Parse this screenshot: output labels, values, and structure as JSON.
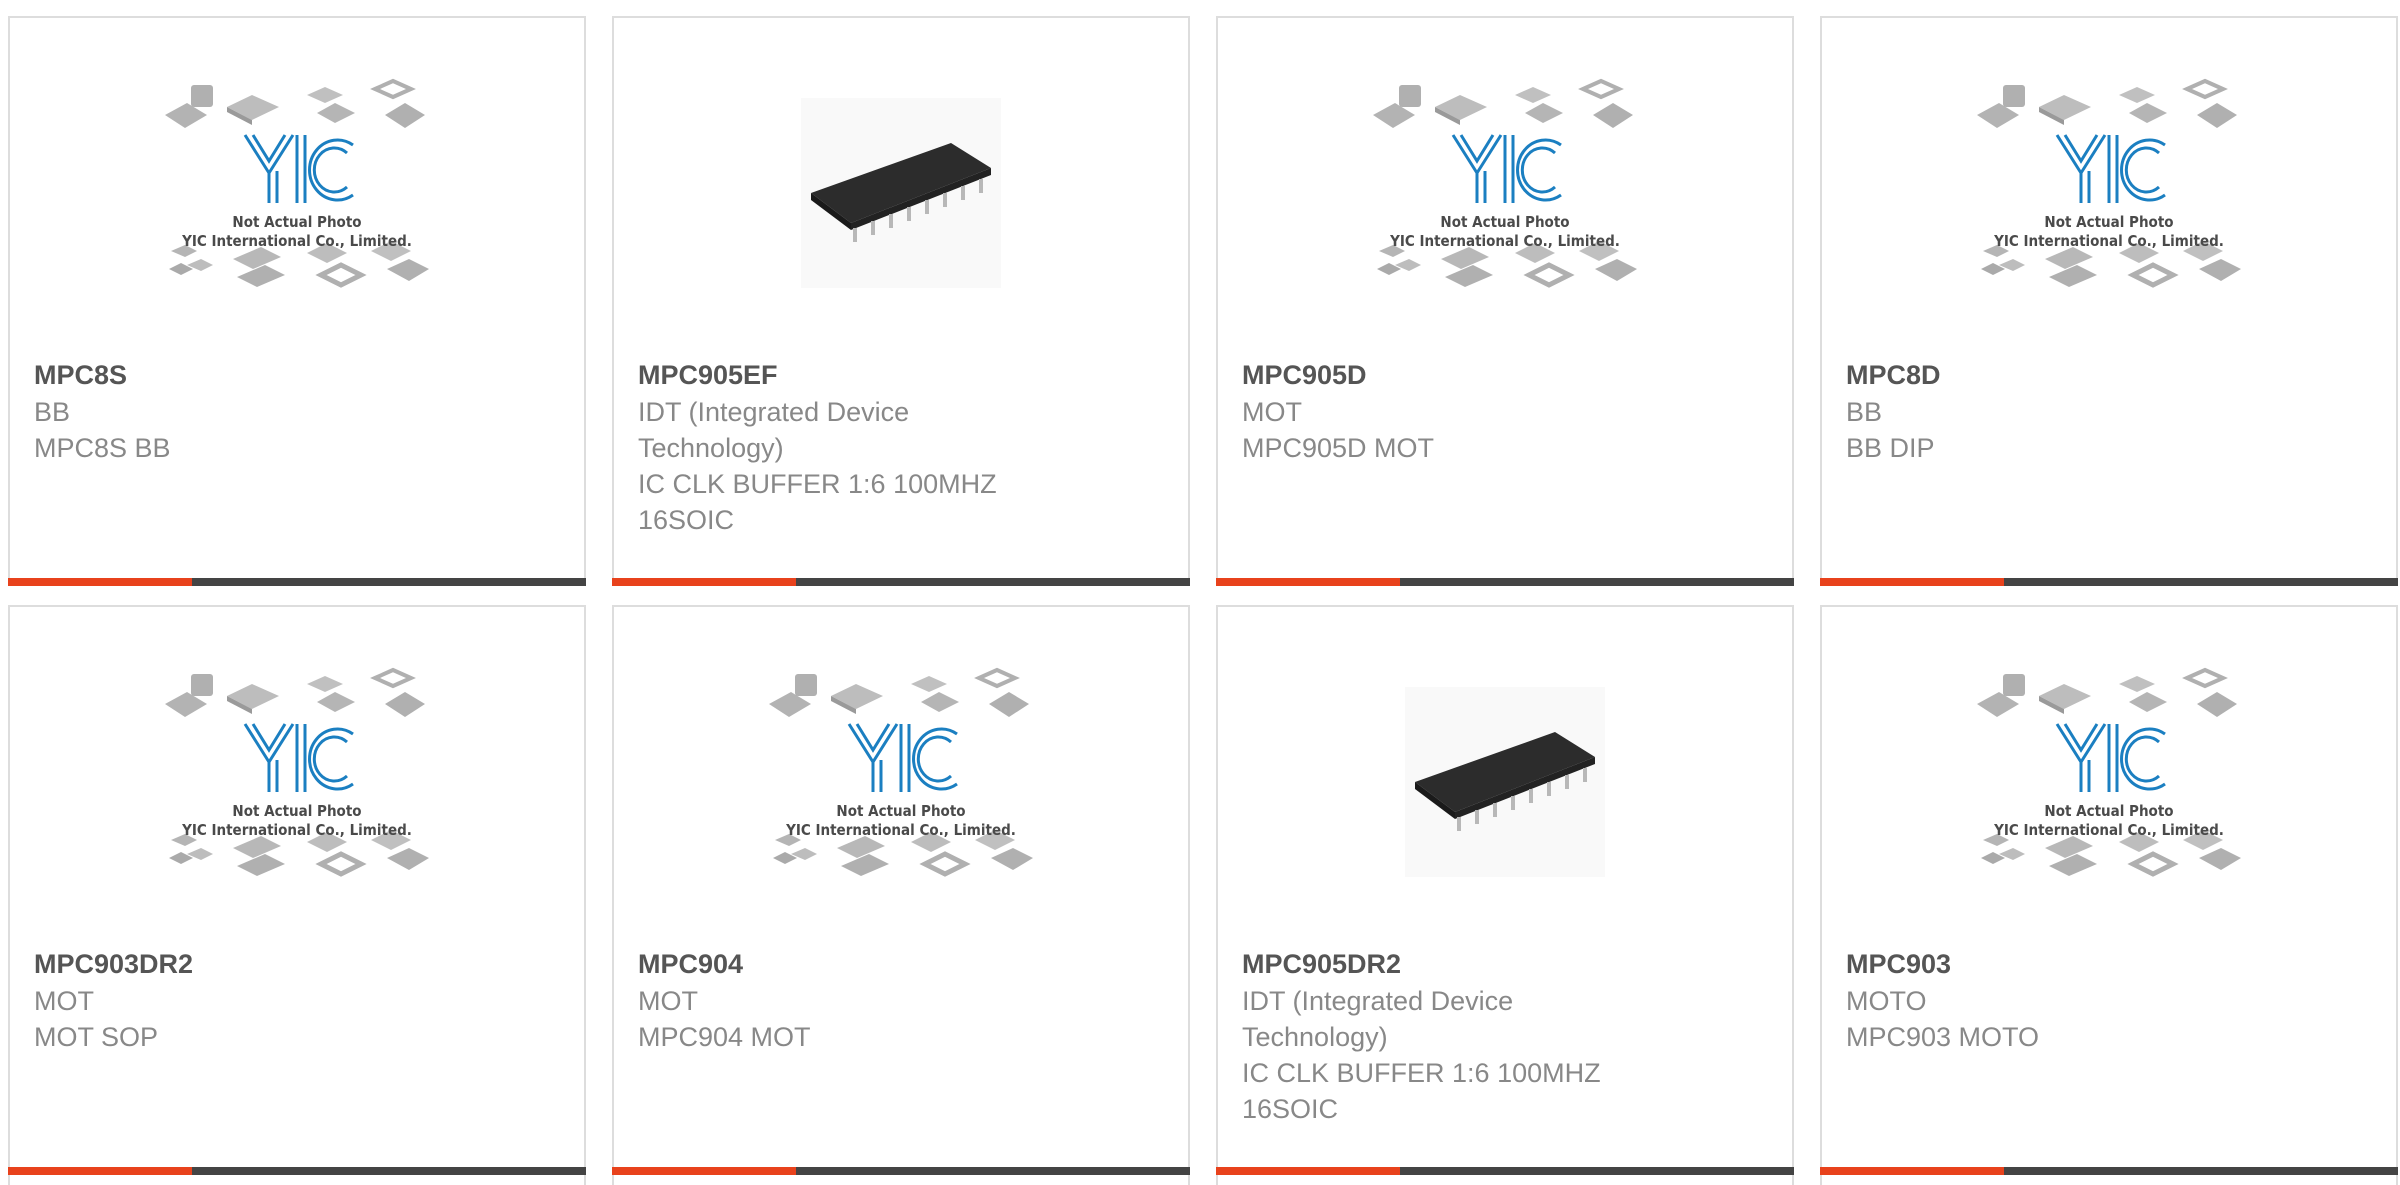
{
  "accent_color": "#e8421c",
  "bar_color": "#444444",
  "products": [
    {
      "part": "MPC8S",
      "manufacturer": "BB",
      "description": "MPC8S BB",
      "image": "yic-placeholder",
      "image_caption": [
        "Not Actual Photo",
        "YIC International Co., Limited."
      ]
    },
    {
      "part": "MPC905EF",
      "manufacturer": "IDT (Integrated Device Technology)",
      "description": "IC CLK BUFFER 1:6 100MHZ 16SOIC",
      "image": "soic-chip-photo"
    },
    {
      "part": "MPC905D",
      "manufacturer": "MOT",
      "description": "MPC905D MOT",
      "image": "yic-placeholder",
      "image_caption": [
        "Not Actual Photo",
        "YIC International Co., Limited."
      ]
    },
    {
      "part": "MPC8D",
      "manufacturer": "BB",
      "description": "BB DIP",
      "image": "yic-placeholder",
      "image_caption": [
        "Not Actual Photo",
        "YIC International Co., Limited."
      ]
    },
    {
      "part": "MPC903DR2",
      "manufacturer": "MOT",
      "description": "MOT SOP",
      "image": "yic-placeholder",
      "image_caption": [
        "Not Actual Photo",
        "YIC International Co., Limited."
      ]
    },
    {
      "part": "MPC904",
      "manufacturer": "MOT",
      "description": "MPC904 MOT",
      "image": "yic-placeholder",
      "image_caption": [
        "Not Actual Photo",
        "YIC International Co., Limited."
      ]
    },
    {
      "part": "MPC905DR2",
      "manufacturer": "IDT (Integrated Device Technology)",
      "description": "IC CLK BUFFER 1:6 100MHZ 16SOIC",
      "image": "soic-chip-photo"
    },
    {
      "part": "MPC903",
      "manufacturer": "MOTO",
      "description": "MPC903 MOTO",
      "image": "yic-placeholder",
      "image_caption": [
        "Not Actual Photo",
        "YIC International Co., Limited."
      ]
    }
  ]
}
